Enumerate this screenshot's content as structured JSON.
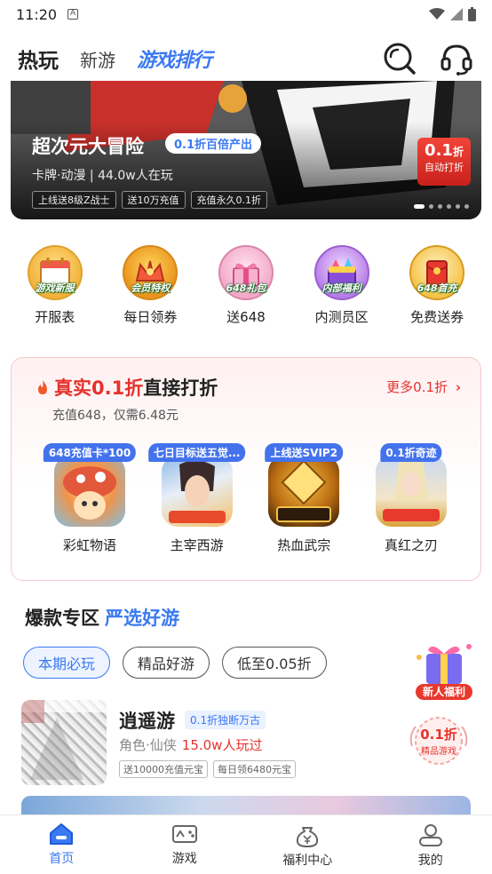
{
  "status_bar": {
    "time": "11:20"
  },
  "header": {
    "tabs": [
      {
        "label": "热玩"
      },
      {
        "label": "新游"
      },
      {
        "label": "游戏排行"
      }
    ],
    "icons": [
      "search-icon",
      "headset-icon"
    ]
  },
  "banner": {
    "title": "超次元大冒险",
    "badge": "0.1折百倍产出",
    "sub": "卡牌·动漫 | 44.0w人在玩",
    "tags": [
      "上线送8级Z战士",
      "送10万充值",
      "充值永久0.1折"
    ],
    "discount_big": "0.1",
    "discount_unit": "折",
    "discount_label": "自动打折",
    "dots_count": 6
  },
  "quick_entries": [
    {
      "label": "开服表",
      "icon_text": "游戏新服"
    },
    {
      "label": "每日领券",
      "icon_text": "会员特权"
    },
    {
      "label": "送648",
      "icon_text": "648礼包"
    },
    {
      "label": "内测员区",
      "icon_text": "内部福利"
    },
    {
      "label": "免费送券",
      "icon_text": "648首充"
    }
  ],
  "discount_section": {
    "title_red": "真实0.1折",
    "title_rest": "直接打折",
    "more": "更多0.1折",
    "sub": "充值648，仅需6.48元",
    "games": [
      {
        "name": "彩虹物语",
        "tag": "648充值卡*100"
      },
      {
        "name": "主宰西游",
        "tag": "七日目标送五觉..."
      },
      {
        "name": "热血武宗",
        "tag": "上线送SVIP2"
      },
      {
        "name": "真红之刃",
        "tag": "0.1折奇迹"
      }
    ]
  },
  "hot_section": {
    "title": "爆款专区",
    "title_blue": "严选好游",
    "chips": [
      "本期必玩",
      "精品好游",
      "低至0.05折"
    ],
    "newbie_label": "新人福利"
  },
  "game_row": {
    "name": "逍遥游",
    "badge": "0.1折独断万古",
    "category": "角色·仙侠",
    "players": "15.0w人玩过",
    "tags": [
      "送10000充值元宝",
      "每日领6480元宝"
    ],
    "seal_big": "0.1折",
    "seal_small": "精品游戏"
  },
  "tab_bar": [
    {
      "label": "首页"
    },
    {
      "label": "游戏"
    },
    {
      "label": "福利中心"
    },
    {
      "label": "我的"
    }
  ],
  "colors": {
    "accent": "#3b79f2",
    "red": "#e5322d"
  }
}
